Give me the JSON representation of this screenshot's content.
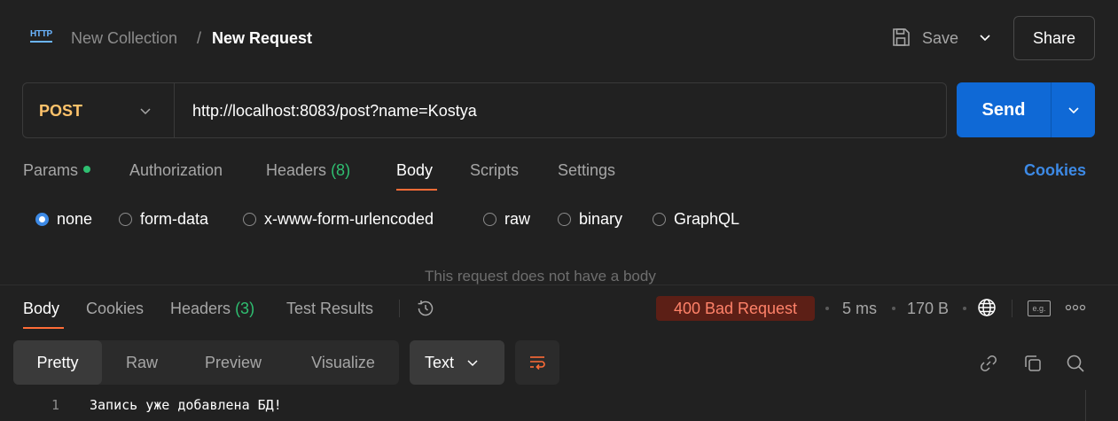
{
  "header": {
    "badge": "HTTP",
    "collection": "New Collection",
    "separator": "/",
    "request_name": "New Request",
    "save_label": "Save",
    "share_label": "Share"
  },
  "request": {
    "method": "POST",
    "url": "http://localhost:8083/post?name=Kostya",
    "send_label": "Send"
  },
  "request_tabs": {
    "params": "Params",
    "authorization": "Authorization",
    "headers": "Headers",
    "headers_count": "(8)",
    "body": "Body",
    "scripts": "Scripts",
    "settings": "Settings",
    "cookies": "Cookies",
    "active": "Body"
  },
  "body_types": {
    "selected": "none",
    "options": [
      "none",
      "form-data",
      "x-www-form-urlencoded",
      "raw",
      "binary",
      "GraphQL"
    ]
  },
  "empty_body_message": "This request does not have a body",
  "response": {
    "tabs": {
      "body": "Body",
      "cookies": "Cookies",
      "headers": "Headers",
      "headers_count": "(3)",
      "test_results": "Test Results",
      "active": "Body"
    },
    "status": "400 Bad Request",
    "time": "5 ms",
    "size": "170 B",
    "example_label": "e.g.",
    "views": [
      "Pretty",
      "Raw",
      "Preview",
      "Visualize"
    ],
    "active_view": "Pretty",
    "format": "Text",
    "lines": [
      {
        "number": "1",
        "text": "Запись уже добавлена БД!"
      }
    ]
  },
  "colors": {
    "background": "#212121",
    "accent_send": "#0f69d6",
    "method_post": "#ffc36b",
    "status_error_bg": "#5c1f16",
    "status_error_text": "#ff8269",
    "tab_underline": "#ff6c37",
    "link": "#3d8ae6",
    "count_green": "#2fbf71"
  }
}
